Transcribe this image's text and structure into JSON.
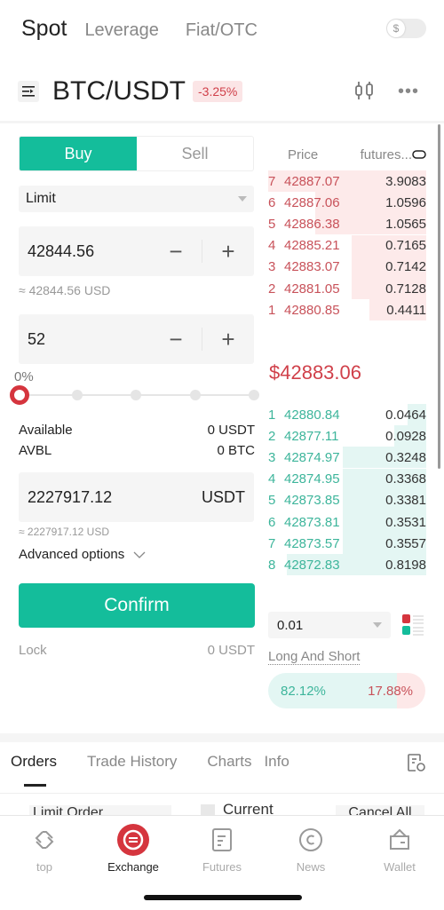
{
  "top_tabs": {
    "spot": "Spot",
    "leverage": "Leverage",
    "fiat": "Fiat/OTC",
    "currency_toggle_symbol": "$"
  },
  "pair": {
    "name": "BTC/USDT",
    "change": "-3.25%"
  },
  "trade": {
    "buy_label": "Buy",
    "sell_label": "Sell",
    "order_type": "Limit",
    "price": "42844.56",
    "price_usd": "≈ 42844.56 USD",
    "amount": "52",
    "percent": "0%",
    "slider_percent": 0,
    "available_label": "Available",
    "available_value": "0 USDT",
    "avbl_label": "AVBL",
    "avbl_value": "0 BTC",
    "total": "2227917.12",
    "total_unit": "USDT",
    "total_usd": "≈ 2227917.12 USD",
    "advanced": "Advanced options",
    "confirm": "Confirm",
    "lock_label": "Lock",
    "lock_value": "0 USDT"
  },
  "orderbook": {
    "price_header": "Price",
    "qty_header": "futures...",
    "asks": [
      {
        "idx": "7",
        "price": "42887.07",
        "qty": "3.9083",
        "depth": 1.0
      },
      {
        "idx": "6",
        "price": "42887.06",
        "qty": "1.0596",
        "depth": 0.7
      },
      {
        "idx": "5",
        "price": "42886.38",
        "qty": "1.0565",
        "depth": 0.7
      },
      {
        "idx": "4",
        "price": "42885.21",
        "qty": "0.7165",
        "depth": 0.47
      },
      {
        "idx": "3",
        "price": "42883.07",
        "qty": "0.7142",
        "depth": 0.47
      },
      {
        "idx": "2",
        "price": "42881.05",
        "qty": "0.7128",
        "depth": 0.47
      },
      {
        "idx": "1",
        "price": "42880.85",
        "qty": "0.4411",
        "depth": 0.36
      }
    ],
    "last_price": "$42883.06",
    "bids": [
      {
        "idx": "1",
        "price": "42880.84",
        "qty": "0.0464",
        "depth": 0.12
      },
      {
        "idx": "2",
        "price": "42877.11",
        "qty": "0.0928",
        "depth": 0.2
      },
      {
        "idx": "3",
        "price": "42874.97",
        "qty": "0.3248",
        "depth": 0.53
      },
      {
        "idx": "4",
        "price": "42874.95",
        "qty": "0.3368",
        "depth": 0.53
      },
      {
        "idx": "5",
        "price": "42873.85",
        "qty": "0.3381",
        "depth": 0.53
      },
      {
        "idx": "6",
        "price": "42873.81",
        "qty": "0.3531",
        "depth": 0.53
      },
      {
        "idx": "7",
        "price": "42873.57",
        "qty": "0.3557",
        "depth": 0.53
      },
      {
        "idx": "8",
        "price": "42872.83",
        "qty": "0.8198",
        "depth": 0.88
      }
    ],
    "precision": "0.01",
    "long_short_label": "Long And Short",
    "long_pct": "82.12%",
    "short_pct": "17.88%",
    "long_ratio": 0.8212,
    "colors": {
      "ask": "#c8525a",
      "bid": "#3db59b",
      "accent": "#14bd9b",
      "down": "#d0404a"
    }
  },
  "orders": {
    "tabs": [
      "Orders",
      "Trade History",
      "Charts",
      "Info"
    ],
    "filter": "Limit Order",
    "current": "Current",
    "cancel_all": "Cancel All"
  },
  "nav": [
    {
      "label": "top",
      "icon": "top-icon"
    },
    {
      "label": "Exchange",
      "icon": "exchange-icon"
    },
    {
      "label": "Futures",
      "icon": "futures-icon"
    },
    {
      "label": "News",
      "icon": "news-icon"
    },
    {
      "label": "Wallet",
      "icon": "wallet-icon"
    }
  ]
}
